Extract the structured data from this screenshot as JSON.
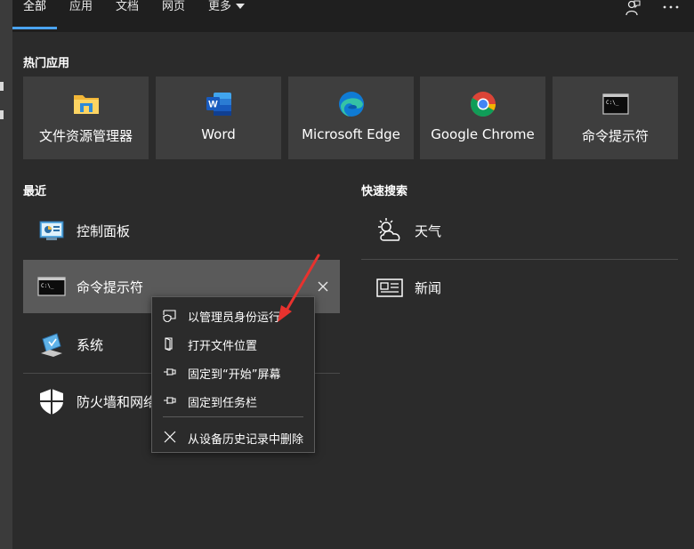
{
  "tabs": [
    {
      "label": "全部",
      "active": true
    },
    {
      "label": "应用",
      "active": false
    },
    {
      "label": "文档",
      "active": false
    },
    {
      "label": "网页",
      "active": false
    },
    {
      "label": "更多",
      "active": false
    }
  ],
  "top_icons": [
    "feedback-icon",
    "more-options-icon"
  ],
  "top_apps": {
    "title": "热门应用",
    "items": [
      {
        "label": "文件资源管理器",
        "icon": "file-explorer-icon"
      },
      {
        "label": "Word",
        "icon": "word-icon"
      },
      {
        "label": "Microsoft Edge",
        "icon": "edge-icon"
      },
      {
        "label": "Google Chrome",
        "icon": "chrome-icon"
      },
      {
        "label": "命令提示符",
        "icon": "cmd-icon"
      }
    ]
  },
  "recent": {
    "title": "最近",
    "items": [
      {
        "label": "控制面板",
        "icon": "control-panel-icon"
      },
      {
        "label": "命令提示符",
        "icon": "cmd-icon"
      },
      {
        "label": "系统",
        "icon": "system-icon"
      },
      {
        "label": "防火墙和网络",
        "icon": "firewall-shield-icon"
      }
    ]
  },
  "quick_search": {
    "title": "快速搜索",
    "items": [
      {
        "label": "天气",
        "icon": "weather-icon"
      },
      {
        "label": "新闻",
        "icon": "news-icon"
      }
    ]
  },
  "context_menu": {
    "items": [
      {
        "label": "以管理员身份运行",
        "icon": "shield-run-icon"
      },
      {
        "label": "打开文件位置",
        "icon": "file-location-icon"
      },
      {
        "label": "固定到“开始”屏幕",
        "icon": "pin-icon"
      },
      {
        "label": "固定到任务栏",
        "icon": "pin-icon"
      },
      {
        "label": "从设备历史记录中删除",
        "icon": "close-icon"
      }
    ]
  },
  "colors": {
    "accent": "#4aa3f0",
    "annotation_arrow": "#e8322e"
  }
}
